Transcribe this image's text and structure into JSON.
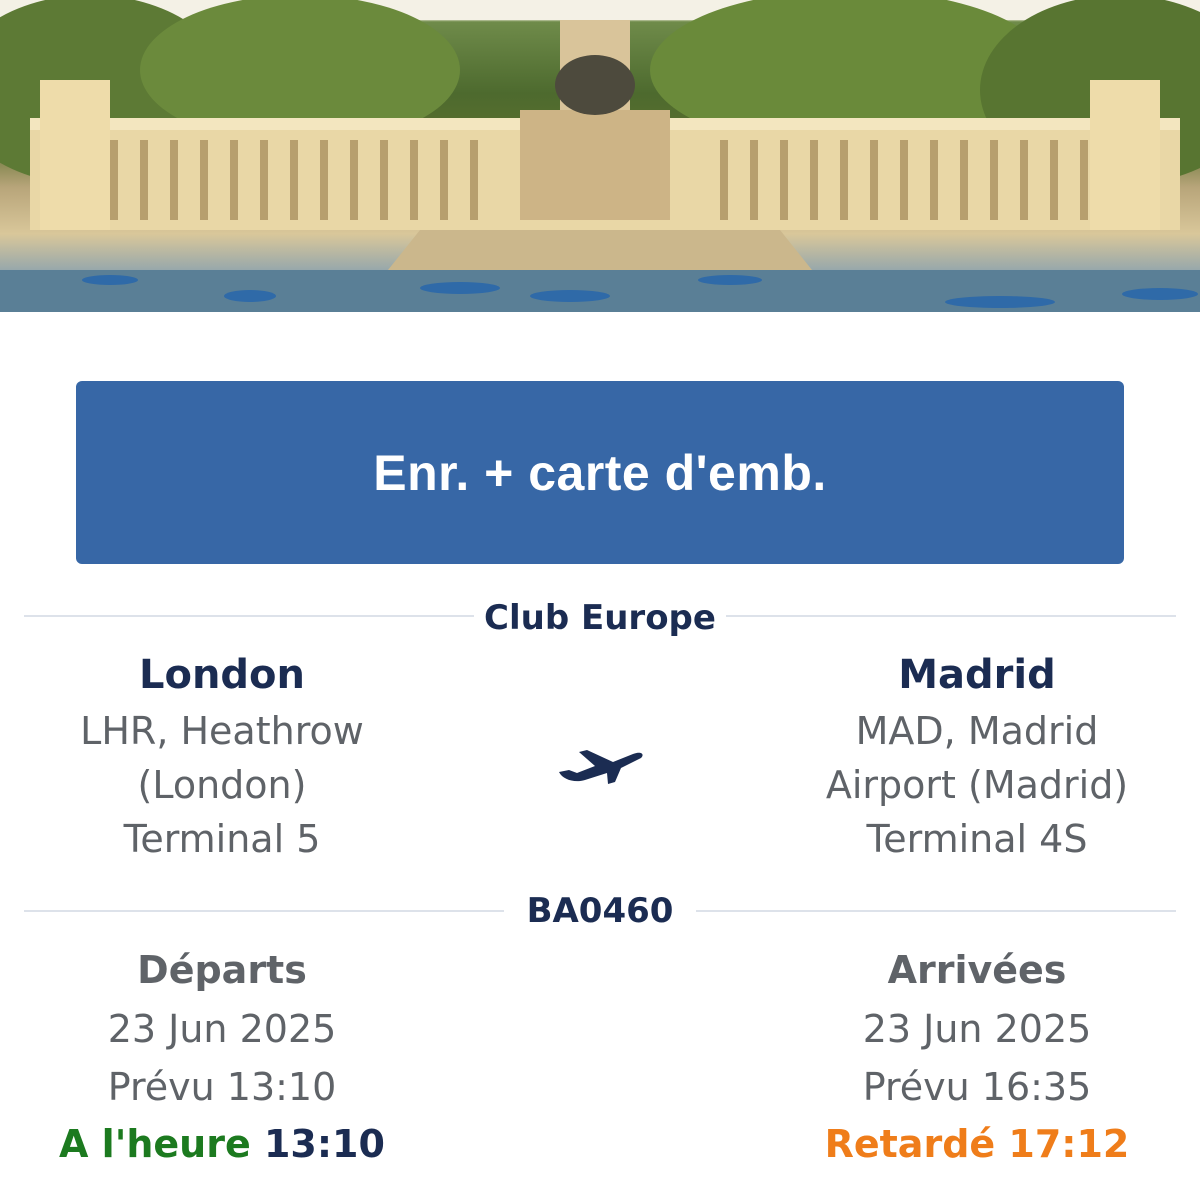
{
  "hero": {
    "icon": "park-monument-photo"
  },
  "checkin_button": {
    "label": "Enr. + carte d'emb."
  },
  "cabin": {
    "label": "Club Europe"
  },
  "origin": {
    "city": "London",
    "airport_line1": "LHR, Heathrow",
    "airport_line2": "(London)",
    "terminal": "Terminal 5"
  },
  "destination": {
    "city": "Madrid",
    "airport_line1": "MAD, Madrid",
    "airport_line2": "Airport (Madrid)",
    "terminal": "Terminal 4S"
  },
  "flight": {
    "number": "BA0460",
    "icon": "airplane-icon"
  },
  "departure": {
    "title": "Départs",
    "date": "23 Jun 2025",
    "scheduled": "Prévu 13:10",
    "status_label": "A l'heure",
    "status_time": "13:10",
    "status_color": "#1c7a1f"
  },
  "arrival": {
    "title": "Arrivées",
    "date": "23 Jun 2025",
    "scheduled": "Prévu 16:35",
    "status_label": "Retardé",
    "status_time": "17:12",
    "status_color": "#ef7d1a"
  },
  "colors": {
    "primary_button": "#3767a6",
    "navy_text": "#1b2c52",
    "grey_text": "#5f6368"
  }
}
